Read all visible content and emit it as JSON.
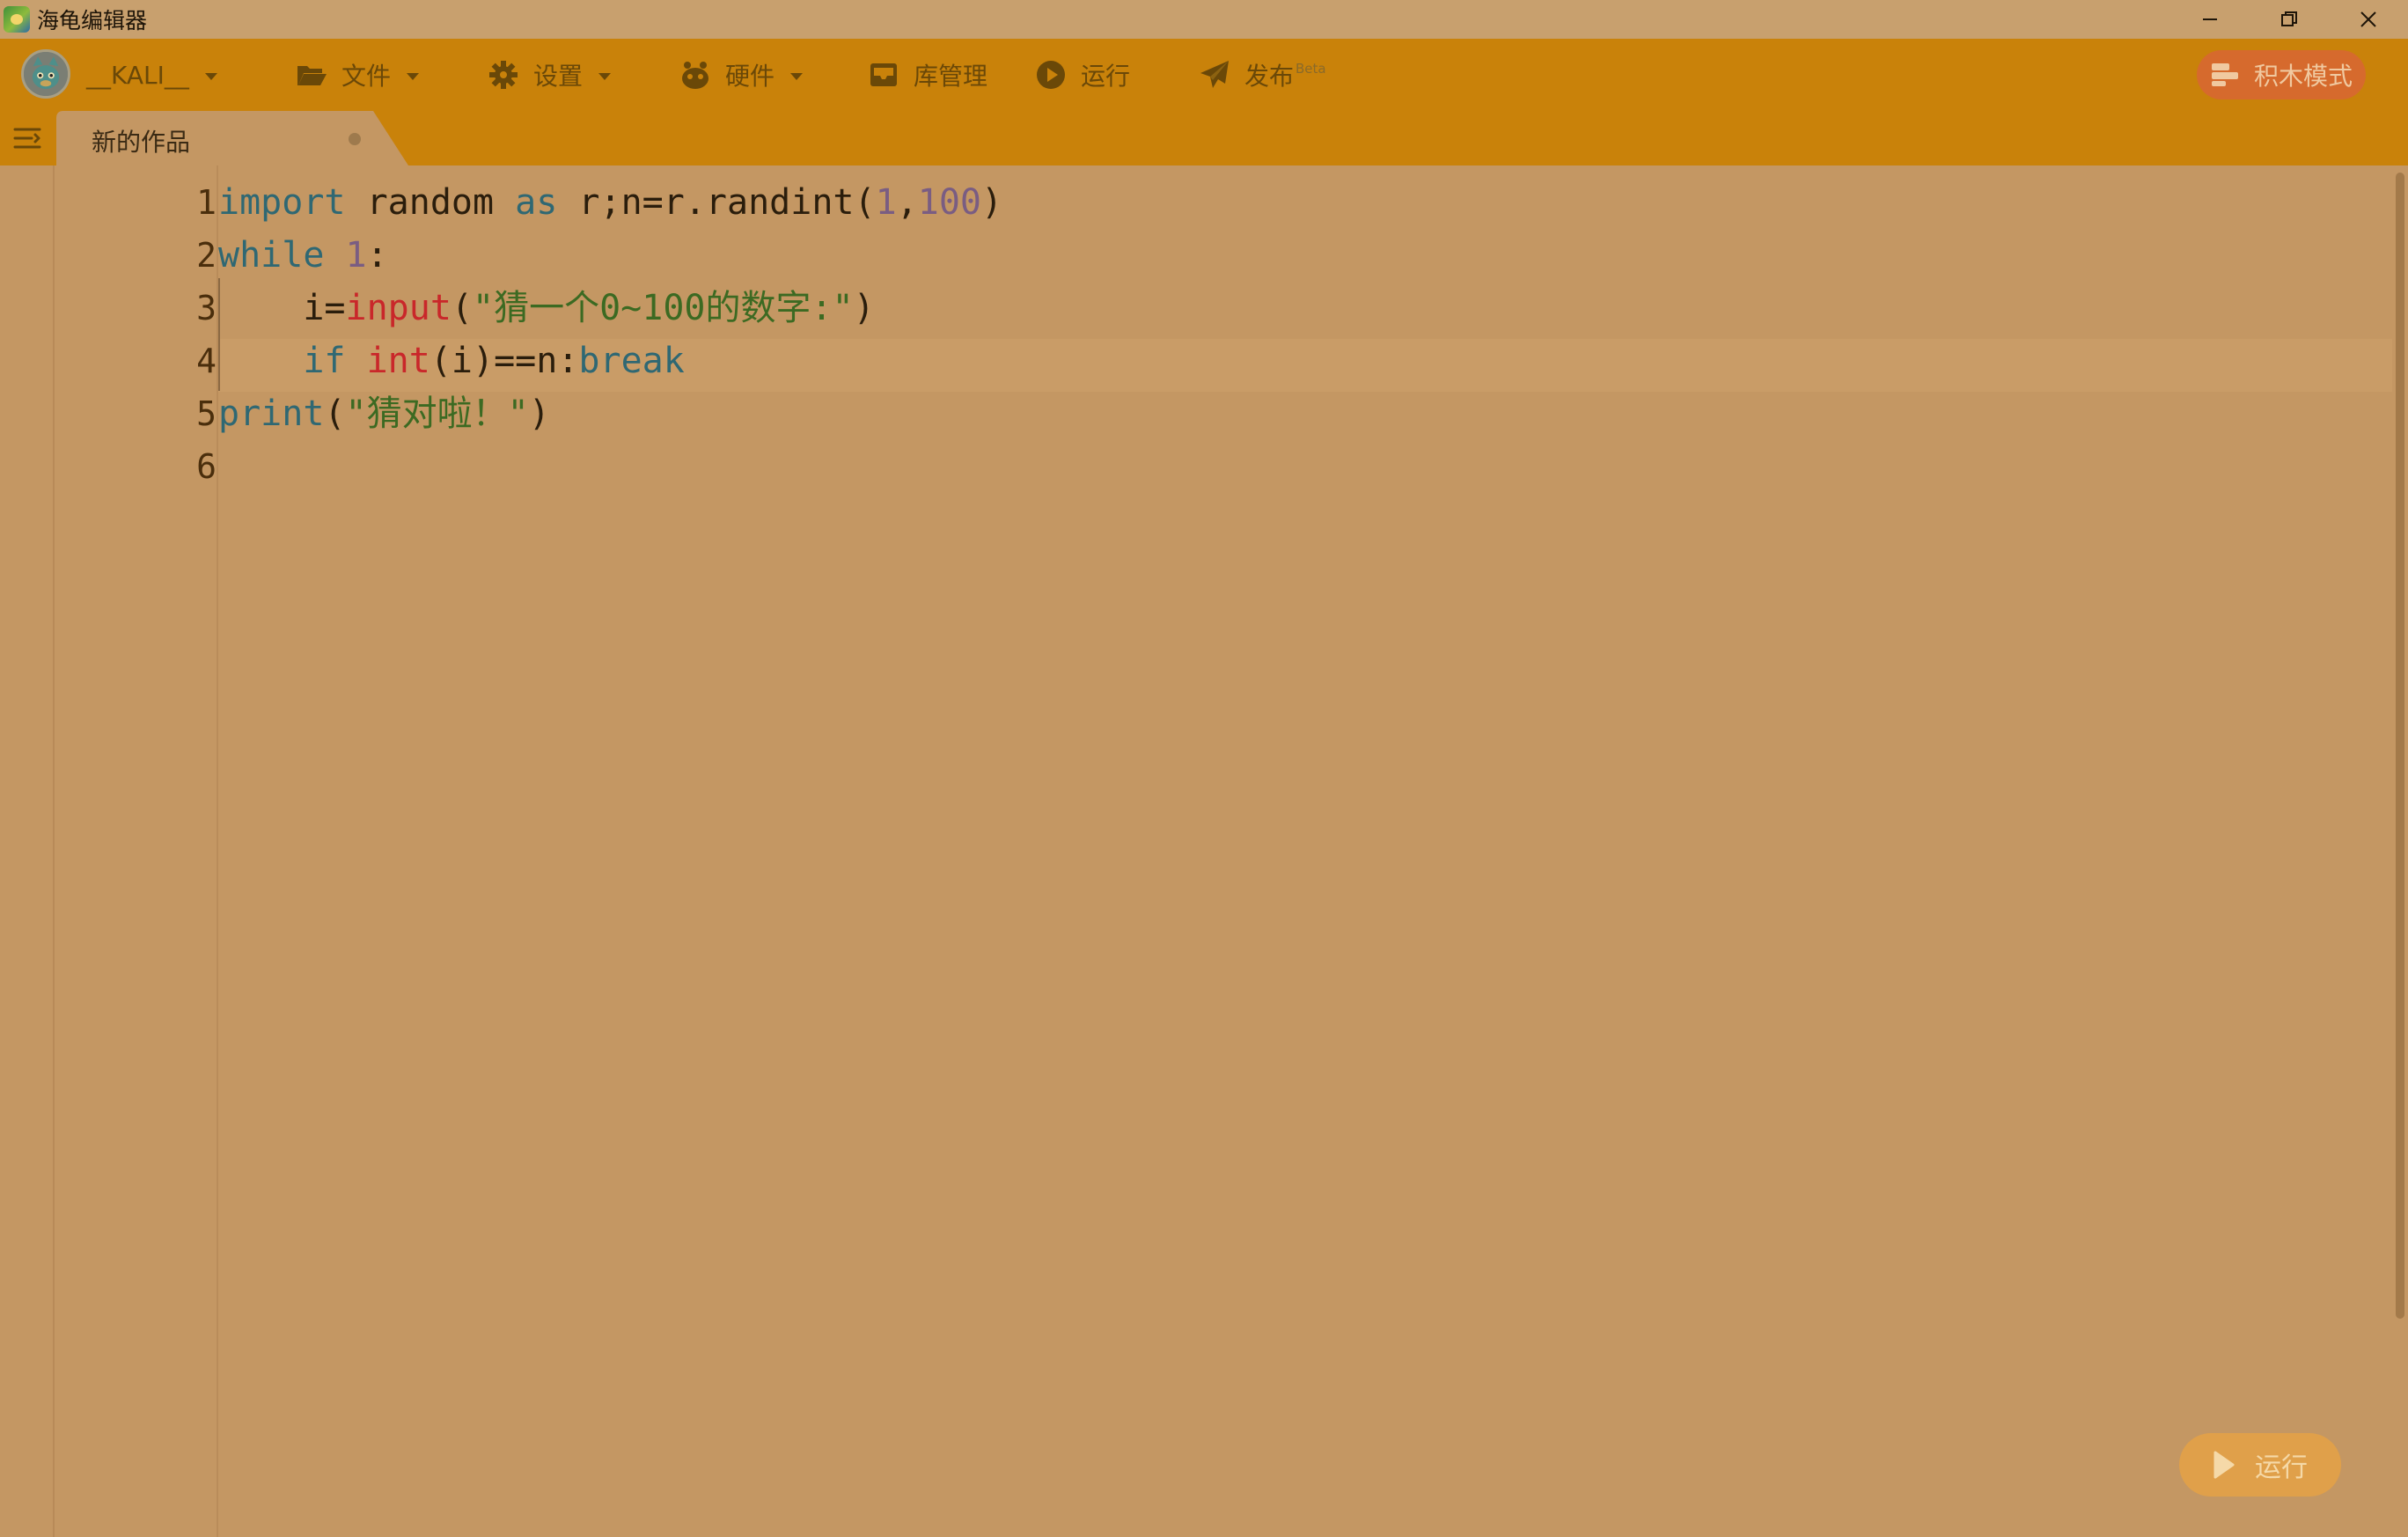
{
  "window": {
    "title": "海龟编辑器"
  },
  "toolbar": {
    "username": "__KALI__",
    "file_label": "文件",
    "settings_label": "设置",
    "hardware_label": "硬件",
    "library_label": "库管理",
    "run_label": "运行",
    "publish_label": "发布",
    "publish_badge": "Beta",
    "block_mode_label": "积木模式"
  },
  "tabs": [
    {
      "label": "新的作品",
      "unsaved": true
    }
  ],
  "editor": {
    "line_numbers": [
      "1",
      "2",
      "3",
      "4",
      "5",
      "6"
    ],
    "current_line": 4,
    "lines": [
      [
        {
          "t": "kw",
          "v": "import"
        },
        {
          "t": "txt",
          "v": " random "
        },
        {
          "t": "kw",
          "v": "as"
        },
        {
          "t": "txt",
          "v": " r;n=r.randint("
        },
        {
          "t": "num",
          "v": "1"
        },
        {
          "t": "txt",
          "v": ","
        },
        {
          "t": "num",
          "v": "100"
        },
        {
          "t": "txt",
          "v": ")"
        }
      ],
      [
        {
          "t": "kw",
          "v": "while"
        },
        {
          "t": "txt",
          "v": " "
        },
        {
          "t": "num",
          "v": "1"
        },
        {
          "t": "txt",
          "v": ":"
        }
      ],
      [
        {
          "t": "txt",
          "v": "    i="
        },
        {
          "t": "bi",
          "v": "input"
        },
        {
          "t": "txt",
          "v": "("
        },
        {
          "t": "str",
          "v": "\"猜一个0~100的数字:\""
        },
        {
          "t": "txt",
          "v": ")"
        }
      ],
      [
        {
          "t": "txt",
          "v": "    "
        },
        {
          "t": "kw",
          "v": "if"
        },
        {
          "t": "txt",
          "v": " "
        },
        {
          "t": "bi",
          "v": "int"
        },
        {
          "t": "txt",
          "v": "(i)==n:"
        },
        {
          "t": "kw",
          "v": "break"
        }
      ],
      [
        {
          "t": "kw",
          "v": "print"
        },
        {
          "t": "txt",
          "v": "("
        },
        {
          "t": "str",
          "v": "\"猜对啦！\""
        },
        {
          "t": "txt",
          "v": ")"
        }
      ],
      []
    ]
  },
  "run_button_label": "运行",
  "colors": {
    "toolbar_bg": "#c9820a",
    "editor_bg": "#c49763",
    "keyword": "#2f6873",
    "number": "#7a5d82",
    "string": "#3c6a22",
    "builtin": "#c9272a",
    "block_mode_bg": "#d66a2d",
    "run_button_bg": "#e0a04a"
  },
  "icons": {
    "file": "folder-open-icon",
    "settings": "gear-icon",
    "hardware": "robot-icon",
    "library": "inbox-icon",
    "run": "play-circle-icon",
    "publish": "paper-plane-icon",
    "block_mode": "blocks-icon",
    "sidebar_toggle": "menu-icon"
  }
}
